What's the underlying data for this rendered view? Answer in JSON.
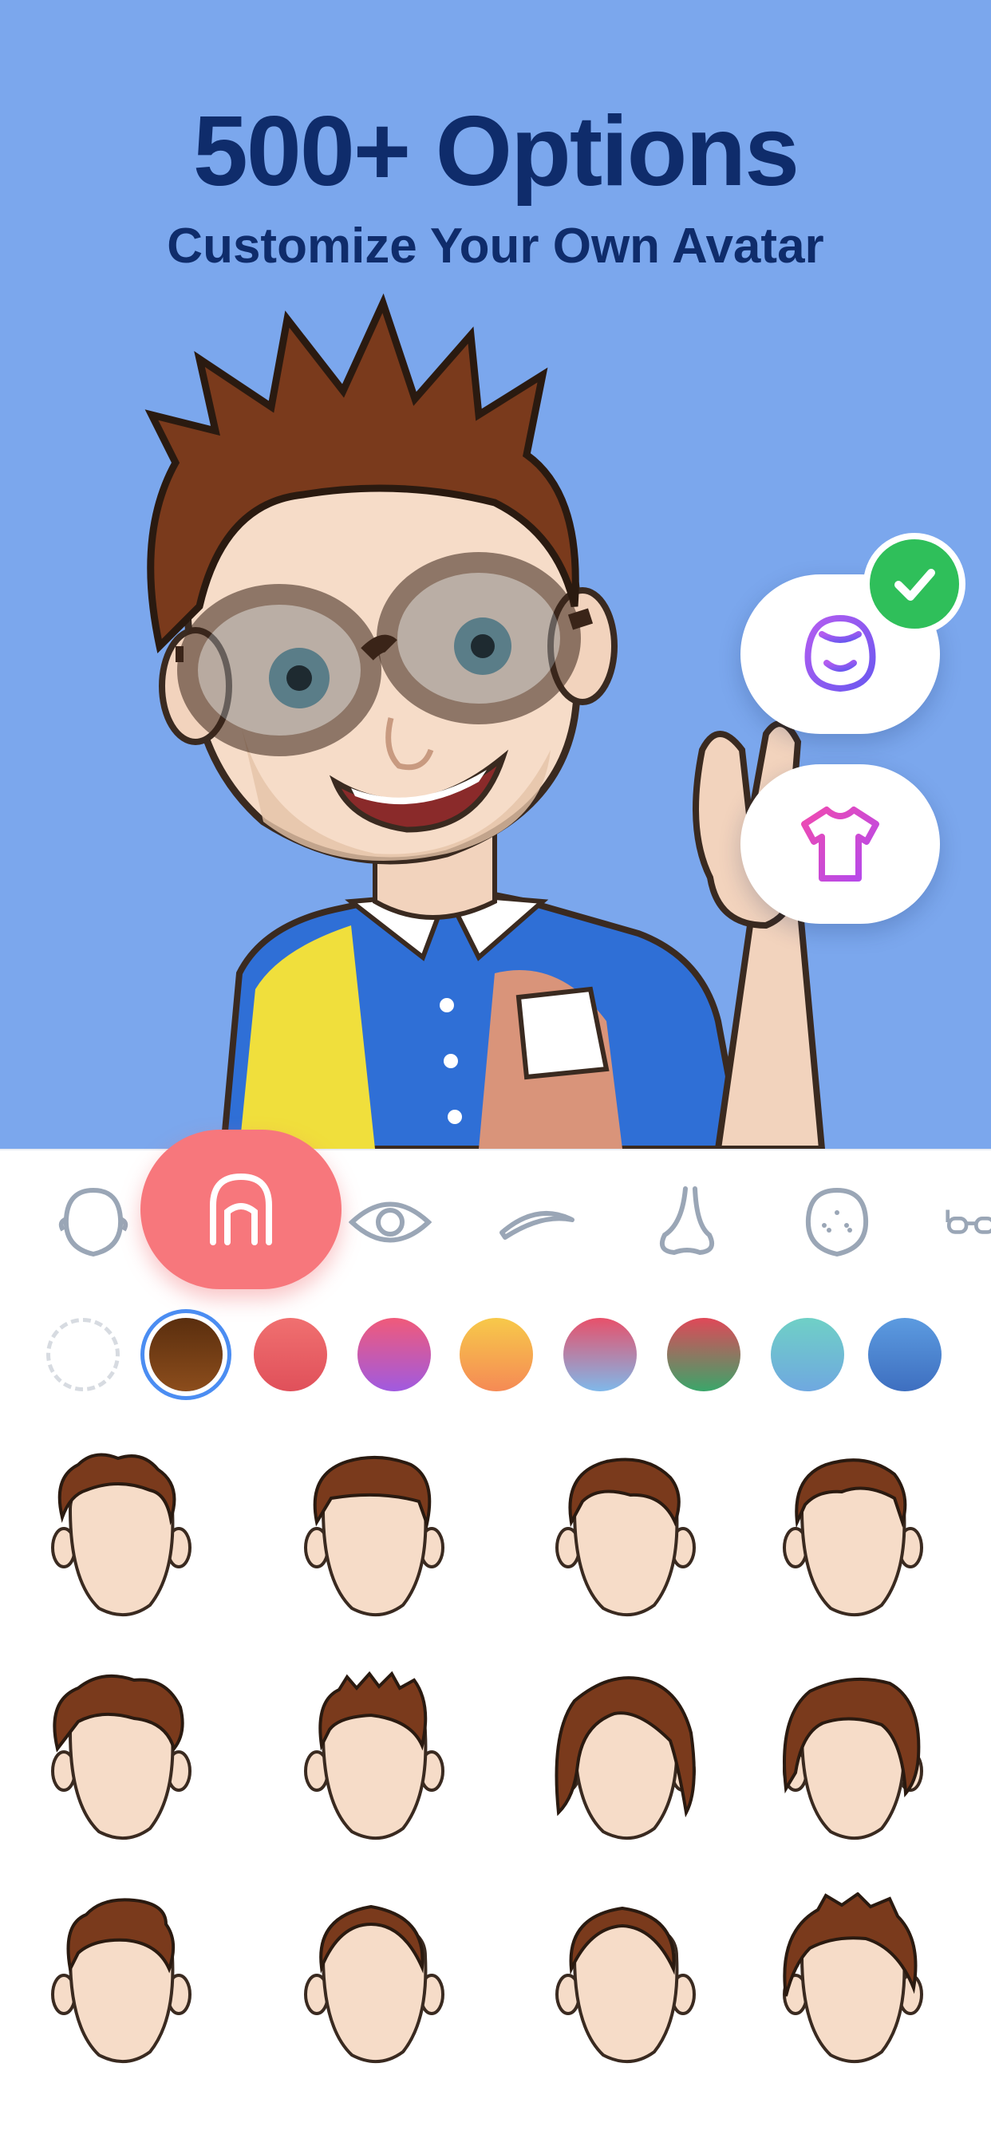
{
  "hero": {
    "title": "500+ Options",
    "subtitle": "Customize Your Own Avatar",
    "background": "#7ba7ed"
  },
  "floating_buttons": [
    {
      "icon": "face-icon",
      "selected": true
    },
    {
      "icon": "shirt-icon",
      "selected": false
    }
  ],
  "categories": [
    {
      "icon": "face-shape-icon"
    },
    {
      "icon": "hair-icon",
      "active": true
    },
    {
      "icon": "eye-icon"
    },
    {
      "icon": "eyebrow-icon"
    },
    {
      "icon": "nose-icon"
    },
    {
      "icon": "freckles-icon"
    },
    {
      "icon": "glasses-icon"
    }
  ],
  "colors": {
    "accent": "#f7777c",
    "selection_ring": "#4b8df2",
    "check": "#2fbf5a",
    "swatches": [
      {
        "name": "none"
      },
      {
        "name": "brown",
        "from": "#5a2e0e",
        "to": "#8c4d1c",
        "selected": true
      },
      {
        "name": "coral",
        "from": "#f07070",
        "to": "#e0505a"
      },
      {
        "name": "pink-purple",
        "from": "#f05a7a",
        "to": "#a05ae0"
      },
      {
        "name": "orange-yellow",
        "from": "#f7c94a",
        "to": "#f58a55"
      },
      {
        "name": "pink-blue",
        "from": "#e8506a",
        "to": "#7fb8ea"
      },
      {
        "name": "red-green",
        "from": "#e04858",
        "to": "#3aa66a"
      },
      {
        "name": "teal",
        "from": "#6fd0c6",
        "to": "#6fa8e0"
      },
      {
        "name": "blue",
        "from": "#5c9be0",
        "to": "#3e6fc0"
      }
    ]
  },
  "hair_styles": [
    {
      "style": "curly-short"
    },
    {
      "style": "bowl-cut"
    },
    {
      "style": "side-swept"
    },
    {
      "style": "classic-part"
    },
    {
      "style": "curly-volume"
    },
    {
      "style": "spiky-crop"
    },
    {
      "style": "long-bob"
    },
    {
      "style": "shaggy-medium"
    },
    {
      "style": "quiff"
    },
    {
      "style": "cornrows"
    },
    {
      "style": "braids-beads"
    },
    {
      "style": "twists"
    }
  ]
}
